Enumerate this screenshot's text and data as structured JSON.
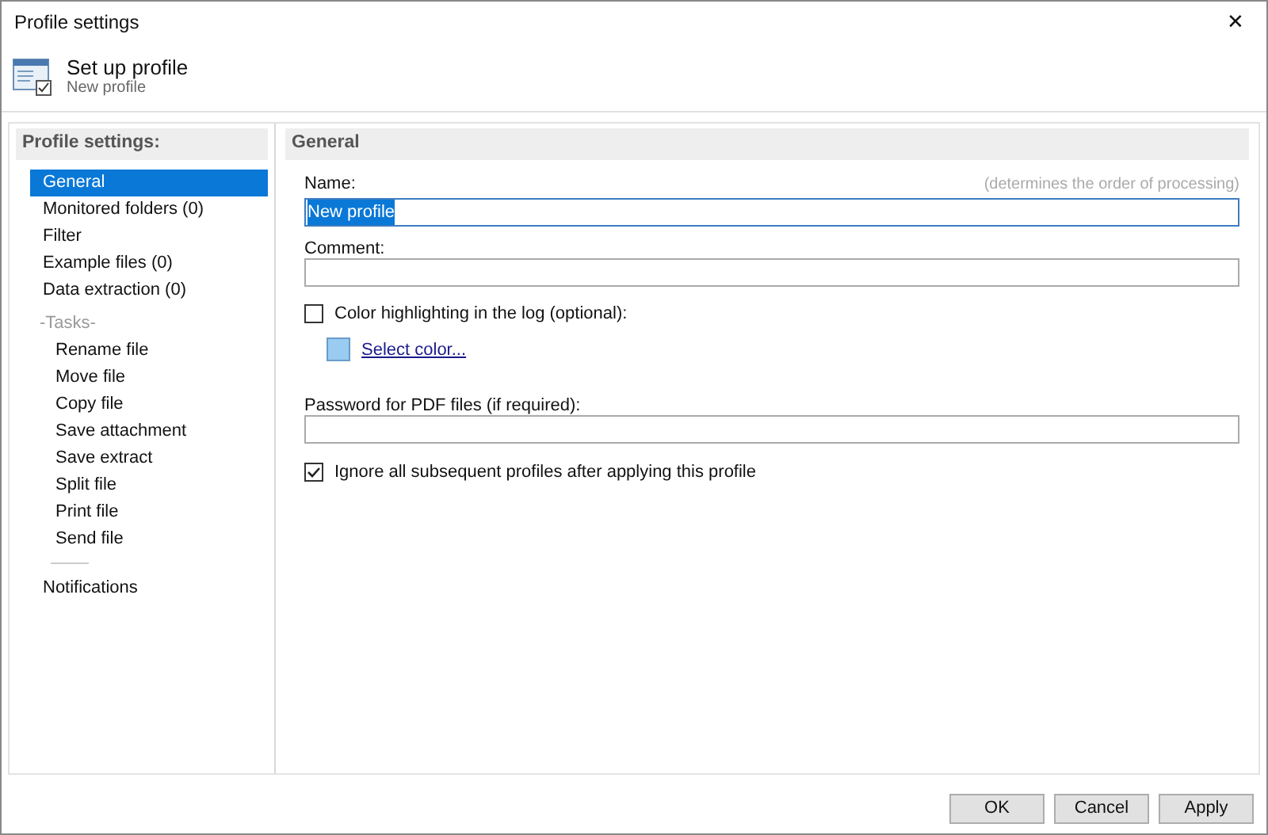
{
  "window": {
    "title": "Profile settings",
    "close": "✕"
  },
  "header": {
    "title": "Set up profile",
    "subtitle": "New profile"
  },
  "sidebar": {
    "title": "Profile settings:",
    "items": [
      {
        "kind": "item",
        "label": "General",
        "selected": true
      },
      {
        "kind": "item",
        "label": "Monitored folders (0)",
        "selected": false
      },
      {
        "kind": "item",
        "label": "Filter",
        "selected": false
      },
      {
        "kind": "item",
        "label": "Example files (0)",
        "selected": false
      },
      {
        "kind": "item",
        "label": "Data extraction (0)",
        "selected": false
      },
      {
        "kind": "heading",
        "label": "-Tasks-"
      },
      {
        "kind": "task",
        "label": "Rename file",
        "selected": false
      },
      {
        "kind": "task",
        "label": "Move file",
        "selected": false
      },
      {
        "kind": "task",
        "label": "Copy file",
        "selected": false
      },
      {
        "kind": "task",
        "label": "Save attachment",
        "selected": false
      },
      {
        "kind": "task",
        "label": "Save extract",
        "selected": false
      },
      {
        "kind": "task",
        "label": "Split file",
        "selected": false
      },
      {
        "kind": "task",
        "label": "Print file",
        "selected": false
      },
      {
        "kind": "task",
        "label": "Send file",
        "selected": false
      },
      {
        "kind": "separator"
      },
      {
        "kind": "item",
        "label": "Notifications",
        "selected": false
      }
    ]
  },
  "panel": {
    "title": "General",
    "name": {
      "label": "Name:",
      "hint": "(determines the order of processing)",
      "value": "New profile",
      "text_selected": true
    },
    "comment": {
      "label": "Comment:"
    },
    "color_highlighting": {
      "label": "Color highlighting in the log (optional):",
      "checked": false,
      "color": "#99ccf0",
      "link": "Select color..."
    },
    "password": {
      "label": "Password for PDF files (if required):"
    },
    "ignore_subsequent": {
      "label": "Ignore all subsequent profiles after applying this profile",
      "checked": true
    }
  },
  "buttons": [
    "OK",
    "Cancel",
    "Apply"
  ]
}
